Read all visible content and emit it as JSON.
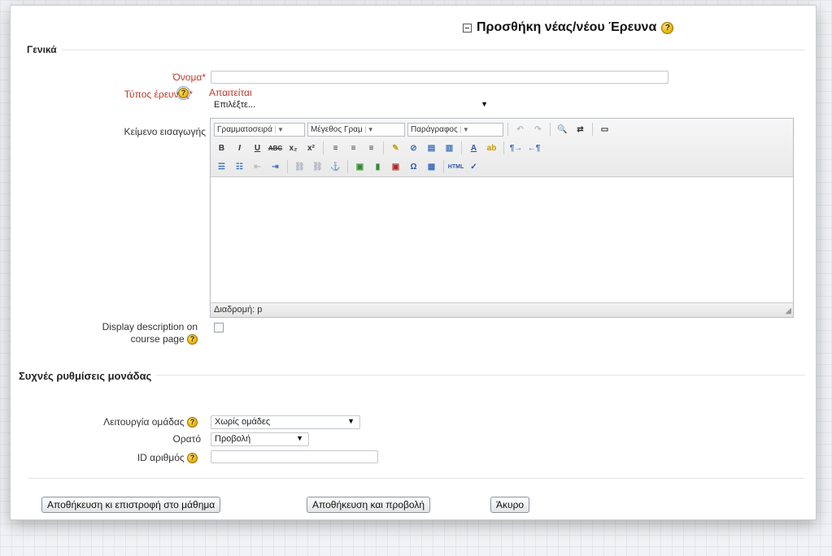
{
  "page": {
    "title": "Προσθήκη νέας/νέου Έρευνα"
  },
  "general": {
    "legend": "Γενικά",
    "name_label": "Όνομα",
    "name_value": "",
    "survey_type_label": "Τύπος έρευνας",
    "required_error": "Απαιτείται",
    "survey_type_value": "Επιλέξτε...",
    "intro_label": "Κείμενο εισαγωγής",
    "editor": {
      "font_family": "Γραμματοσειρά",
      "font_size": "Μέγεθος Γραμ",
      "paragraph": "Παράγραφος",
      "path_label": "Διαδρομή: p",
      "content": ""
    },
    "display_desc_label_1": "Display description on",
    "display_desc_label_2": "course page",
    "display_desc_checked": false
  },
  "common": {
    "legend": "Συχνές ρυθμίσεις μονάδας",
    "group_mode_label": "Λειτουργία ομάδας",
    "group_mode_value": "Χωρίς ομάδες",
    "visible_label": "Ορατό",
    "visible_value": "Προβολή",
    "id_number_label": "ID αριθμός",
    "id_number_value": ""
  },
  "buttons": {
    "save_return": "Αποθήκευση κι επιστροφή στο μάθημα",
    "save_display": "Αποθήκευση και προβολή",
    "cancel": "Άκυρο"
  },
  "colors": {
    "required": "#c0392b",
    "help_icon": "#e7b000"
  },
  "icons": {
    "help": "question-mark-circle",
    "collapse": "minus-square"
  }
}
